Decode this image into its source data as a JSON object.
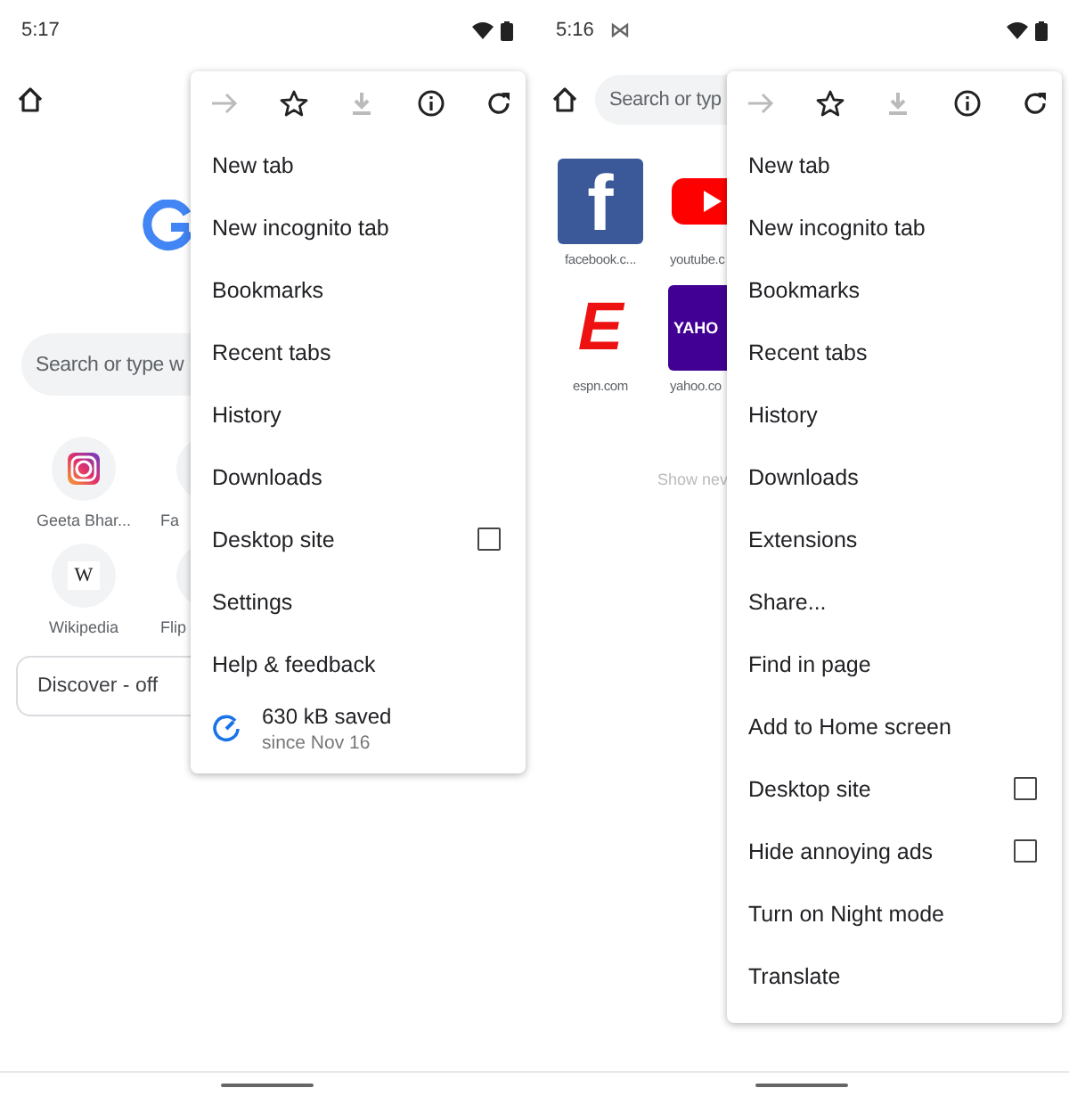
{
  "phones": [
    {
      "status_bar": {
        "time": "5:17",
        "notification_icon": false
      },
      "search": {
        "placeholder": "Search or type w"
      },
      "logo": true,
      "shortcuts": [
        {
          "label": "Geeta Bhar...",
          "kind": "instagram"
        },
        {
          "label": "Fa",
          "kind": "partial"
        },
        {
          "label": "Wikipedia",
          "kind": "wikipedia",
          "logo_text": "W"
        },
        {
          "label": "Flip",
          "kind": "partial"
        }
      ],
      "discover": {
        "label": "Discover - off"
      },
      "menu": {
        "header": [
          {
            "disabled": true
          },
          {
            "disabled": false
          },
          {
            "disabled": true
          },
          {
            "disabled": false
          },
          {
            "disabled": false
          }
        ],
        "items": [
          {
            "kind": "plain",
            "label": "New tab"
          },
          {
            "kind": "plain",
            "label": "New incognito tab"
          },
          {
            "kind": "plain",
            "label": "Bookmarks"
          },
          {
            "kind": "plain",
            "label": "Recent tabs"
          },
          {
            "kind": "plain",
            "label": "History"
          },
          {
            "kind": "plain",
            "label": "Downloads"
          },
          {
            "kind": "checkbox",
            "label": "Desktop site",
            "checked": false
          },
          {
            "kind": "plain",
            "label": "Settings"
          },
          {
            "kind": "plain",
            "label": "Help & feedback"
          },
          {
            "kind": "saved",
            "label": "630 kB saved",
            "sublabel": "since Nov 16"
          }
        ]
      }
    },
    {
      "status_bar": {
        "time": "5:16",
        "notification_icon": true
      },
      "search": {
        "placeholder": "Search or typ"
      },
      "logo": false,
      "tiles": [
        {
          "label": "facebook.c...",
          "kind": "facebook",
          "logo_text": "f"
        },
        {
          "label": "youtube.c",
          "kind": "youtube"
        },
        {
          "label": "espn.com",
          "kind": "espn",
          "logo_text": "E"
        },
        {
          "label": "yahoo.co",
          "kind": "yahoo",
          "logo_text": "YAHO"
        }
      ],
      "show_more": {
        "label": "Show nev"
      },
      "menu": {
        "header": [
          {
            "disabled": true
          },
          {
            "disabled": false
          },
          {
            "disabled": true
          },
          {
            "disabled": false
          },
          {
            "disabled": false
          }
        ],
        "items": [
          {
            "kind": "plain",
            "label": "New tab"
          },
          {
            "kind": "plain",
            "label": "New incognito tab"
          },
          {
            "kind": "plain",
            "label": "Bookmarks"
          },
          {
            "kind": "plain",
            "label": "Recent tabs"
          },
          {
            "kind": "plain",
            "label": "History"
          },
          {
            "kind": "plain",
            "label": "Downloads"
          },
          {
            "kind": "plain",
            "label": "Extensions"
          },
          {
            "kind": "plain",
            "label": "Share..."
          },
          {
            "kind": "plain",
            "label": "Find in page"
          },
          {
            "kind": "plain",
            "label": "Add to Home screen"
          },
          {
            "kind": "checkbox",
            "label": "Desktop site",
            "checked": false
          },
          {
            "kind": "checkbox",
            "label": "Hide annoying ads",
            "checked": false
          },
          {
            "kind": "plain",
            "label": "Turn on Night mode"
          },
          {
            "kind": "plain",
            "label": "Translate"
          }
        ]
      }
    }
  ]
}
